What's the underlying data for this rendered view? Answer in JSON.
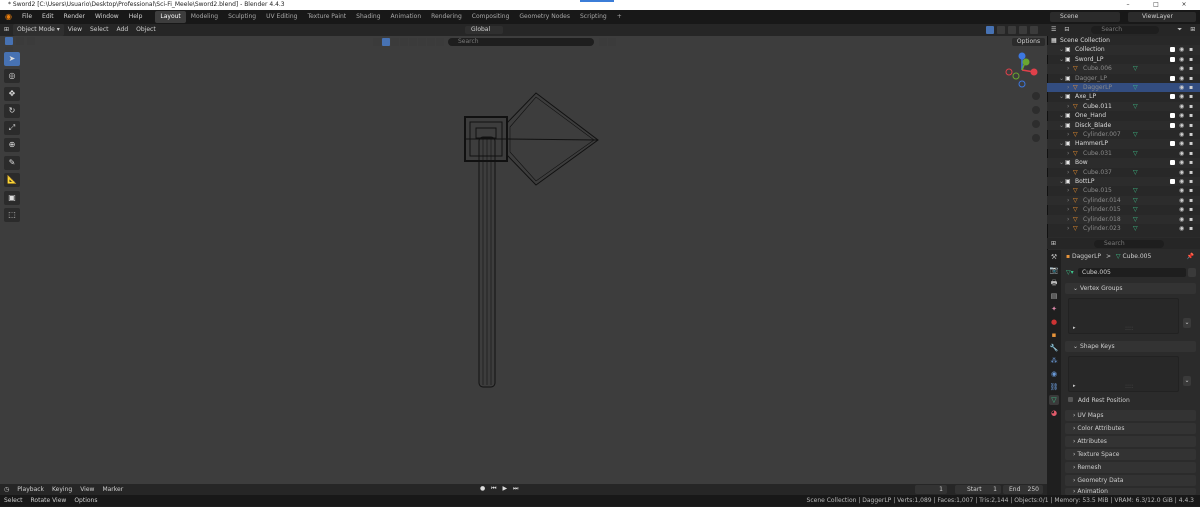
{
  "window": {
    "title": "* Sword2 [C:\\Users\\Usuario\\Desktop\\Professional\\Sci-Fi_Meele\\Sword2.blend] - Blender 4.4.3"
  },
  "menu": [
    "File",
    "Edit",
    "Render",
    "Window",
    "Help"
  ],
  "workspaces": [
    "Layout",
    "Modeling",
    "Sculpting",
    "UV Editing",
    "Texture Paint",
    "Shading",
    "Animation",
    "Rendering",
    "Compositing",
    "Geometry Nodes",
    "Scripting"
  ],
  "workspace_add": "+",
  "scene": {
    "label": "Scene",
    "viewlayer": "ViewLayer"
  },
  "viewport_header": {
    "mode": "Object Mode",
    "items": [
      "View",
      "Select",
      "Add",
      "Object"
    ],
    "orientation": "Global",
    "search_placeholder": "Search",
    "options": "Options"
  },
  "timeline": {
    "items": [
      "Playback",
      "Keying",
      "View",
      "Marker"
    ],
    "current_frame": "1",
    "start_label": "Start",
    "start": "1",
    "end_label": "End",
    "end": "250"
  },
  "status": {
    "left": [
      "Select",
      "Rotate View",
      "Options"
    ],
    "right": "Scene Collection | DaggerLP | Verts:1,089 | Faces:1,007 | Tris:2,144 | Objects:0/1 | Memory: 53.5 MiB | VRAM: 6.3/12.0 GiB | 4.4.3"
  },
  "outliner": {
    "search_placeholder": "Search",
    "rows": [
      {
        "label": "Scene Collection",
        "indent": 0,
        "kind": "scene",
        "dim": false,
        "check": false,
        "eye": false,
        "cam": false
      },
      {
        "label": "Collection",
        "indent": 1,
        "kind": "collection",
        "dim": false,
        "check": true,
        "eye": true,
        "cam": true
      },
      {
        "label": "Sword_LP",
        "indent": 1,
        "kind": "collection",
        "dim": false,
        "check": true,
        "eye": true,
        "cam": true
      },
      {
        "label": "Cube.006",
        "indent": 2,
        "kind": "mesh",
        "dim": true,
        "check": false,
        "eye": true,
        "cam": true
      },
      {
        "label": "Dagger_LP",
        "indent": 1,
        "kind": "collection",
        "dim": true,
        "check": true,
        "eye": true,
        "cam": true
      },
      {
        "label": "DaggerLP",
        "indent": 2,
        "kind": "mesh",
        "dim": true,
        "check": false,
        "eye": true,
        "cam": true,
        "selected": true
      },
      {
        "label": "Axe_LP",
        "indent": 1,
        "kind": "collection",
        "dim": false,
        "check": true,
        "eye": true,
        "cam": true
      },
      {
        "label": "Cube.011",
        "indent": 2,
        "kind": "mesh",
        "dim": false,
        "check": false,
        "eye": true,
        "cam": true
      },
      {
        "label": "One_Hand",
        "indent": 1,
        "kind": "collection",
        "dim": false,
        "check": true,
        "eye": true,
        "cam": true
      },
      {
        "label": "Disck_Blade",
        "indent": 1,
        "kind": "collection",
        "dim": false,
        "check": true,
        "eye": true,
        "cam": true
      },
      {
        "label": "Cylinder.007",
        "indent": 2,
        "kind": "mesh",
        "dim": true,
        "check": false,
        "eye": true,
        "cam": true
      },
      {
        "label": "HammerLP",
        "indent": 1,
        "kind": "collection",
        "dim": false,
        "check": true,
        "eye": true,
        "cam": true
      },
      {
        "label": "Cube.031",
        "indent": 2,
        "kind": "mesh",
        "dim": true,
        "check": false,
        "eye": true,
        "cam": true
      },
      {
        "label": "Bow",
        "indent": 1,
        "kind": "collection",
        "dim": false,
        "check": true,
        "eye": true,
        "cam": true
      },
      {
        "label": "Cube.037",
        "indent": 2,
        "kind": "mesh",
        "dim": true,
        "check": false,
        "eye": true,
        "cam": true
      },
      {
        "label": "BottLP",
        "indent": 1,
        "kind": "collection",
        "dim": false,
        "check": true,
        "eye": true,
        "cam": true
      },
      {
        "label": "Cube.015",
        "indent": 2,
        "kind": "mesh",
        "dim": true,
        "check": false,
        "eye": true,
        "cam": true
      },
      {
        "label": "Cylinder.014",
        "indent": 2,
        "kind": "mesh",
        "dim": true,
        "check": false,
        "eye": true,
        "cam": true
      },
      {
        "label": "Cylinder.015",
        "indent": 2,
        "kind": "mesh",
        "dim": true,
        "check": false,
        "eye": true,
        "cam": true
      },
      {
        "label": "Cylinder.018",
        "indent": 2,
        "kind": "mesh",
        "dim": true,
        "check": false,
        "eye": true,
        "cam": true
      },
      {
        "label": "Cylinder.023",
        "indent": 2,
        "kind": "mesh",
        "dim": true,
        "check": false,
        "eye": true,
        "cam": true
      }
    ]
  },
  "properties": {
    "search_placeholder": "Search",
    "breadcrumb": {
      "object": "DaggerLP",
      "sep": ">",
      "data": "Cube.005"
    },
    "datablock": "Cube.005",
    "panels_open": [
      "Vertex Groups",
      "Shape Keys"
    ],
    "add_rest_position": "Add Rest Position",
    "panels_closed": [
      "UV Maps",
      "Color Attributes",
      "Attributes",
      "Texture Space",
      "Remesh",
      "Geometry Data",
      "Animation"
    ]
  },
  "colors": {
    "accent": "#4772b3",
    "selection": "#334d80",
    "mesh_icon": "#ff9a2e",
    "data_icon": "#3ec48c",
    "viewport": "#3d3d3d",
    "wire": "#111111"
  }
}
